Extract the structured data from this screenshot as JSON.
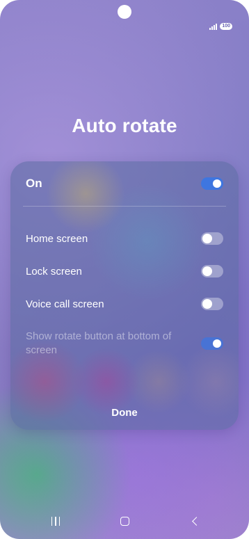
{
  "status_bar": {
    "battery": "100",
    "signal_icon": "signal-icon"
  },
  "title": "Auto rotate",
  "main_toggle": {
    "label": "On",
    "state": "on"
  },
  "options": [
    {
      "label": "Home screen",
      "state": "off"
    },
    {
      "label": "Lock screen",
      "state": "off"
    },
    {
      "label": "Voice call screen",
      "state": "off"
    },
    {
      "label": "Show rotate button at bottom of screen",
      "state": "on",
      "enabled": false
    }
  ],
  "done_label": "Done",
  "navigation": {
    "recent_icon": "recent-apps-icon",
    "home_icon": "home-icon",
    "back_icon": "back-icon"
  },
  "colors": {
    "accent": "#3e76e0",
    "text": "#ffffff"
  }
}
